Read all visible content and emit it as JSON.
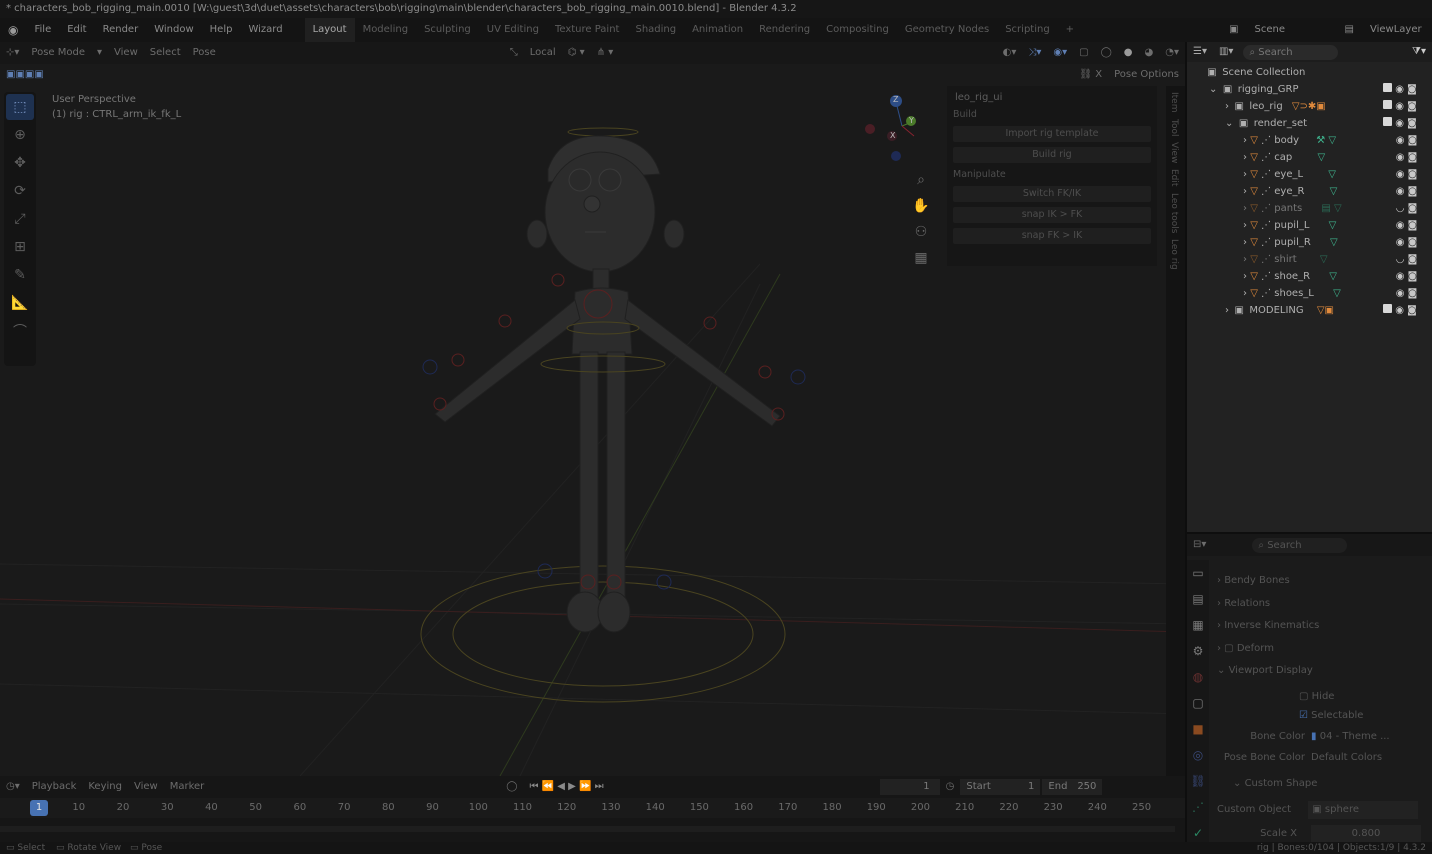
{
  "titlebar": {
    "text": "* characters_bob_rigging_main.0010 [W:\\guest\\3d\\duet\\assets\\characters\\bob\\rigging\\main\\blender\\characters_bob_rigging_main.0010.blend] - Blender 4.3.2"
  },
  "menu": {
    "items": [
      "File",
      "Edit",
      "Render",
      "Window",
      "Help",
      "Wizard"
    ]
  },
  "workspaces": {
    "tabs": [
      "Layout",
      "Modeling",
      "Sculpting",
      "UV Editing",
      "Texture Paint",
      "Shading",
      "Animation",
      "Rendering",
      "Compositing",
      "Geometry Nodes",
      "Scripting"
    ],
    "add": "+"
  },
  "scene": {
    "label": "Scene",
    "view_layer": "ViewLayer"
  },
  "viewport_header": {
    "mode": "Pose Mode",
    "view": "View",
    "select": "Select",
    "pose": "Pose",
    "transform_orientation": "Local",
    "pose_options": "Pose Options"
  },
  "viewport": {
    "perspective": "User Perspective",
    "active": "(1) rig : CTRL_arm_ik_fk_L"
  },
  "gizmo": {
    "z": "Z",
    "y": "Y",
    "x": "X"
  },
  "npanel": {
    "title": "leo_rig_ui",
    "build_label": "Build",
    "import_btn": "Import rig template",
    "build_btn": "Build rig",
    "manipulate_label": "Manipulate",
    "switch_btn": "Switch FK/IK",
    "snap_ik_btn": "snap IK > FK",
    "snap_fk_btn": "snap FK > IK",
    "tabs": [
      "Item",
      "Tool",
      "View",
      "Edit",
      "Leo tools",
      "Leo rig"
    ]
  },
  "outliner": {
    "search_placeholder": "Search",
    "root": "Scene Collection",
    "rows": [
      {
        "label": "rigging_GRP"
      },
      {
        "label": "leo_rig"
      },
      {
        "label": "render_set"
      },
      {
        "label": "body"
      },
      {
        "label": "cap"
      },
      {
        "label": "eye_L"
      },
      {
        "label": "eye_R"
      },
      {
        "label": "pants"
      },
      {
        "label": "pupil_L"
      },
      {
        "label": "pupil_R"
      },
      {
        "label": "shirt"
      },
      {
        "label": "shoe_R"
      },
      {
        "label": "shoes_L"
      },
      {
        "label": "MODELING"
      }
    ]
  },
  "properties": {
    "search_placeholder": "Search",
    "bendy_bones": "Bendy Bones",
    "relations": "Relations",
    "inverse_kinematics": "Inverse Kinematics",
    "deform": "Deform",
    "viewport_display": "Viewport Display",
    "hide": "Hide",
    "selectable": "Selectable",
    "bone_color_label": "Bone Color",
    "bone_color_value": "04 - Theme ...",
    "pose_bone_color_label": "Pose Bone Color",
    "pose_bone_color_value": "Default Colors",
    "custom_shape": "Custom Shape",
    "custom_object_label": "Custom Object",
    "custom_object_value": "sphere",
    "scale_x_label": "Scale X",
    "scale_x_value": "0.800"
  },
  "timeline": {
    "playback": "Playback",
    "keying": "Keying",
    "view": "View",
    "marker": "Marker",
    "current_frame": "1",
    "start_label": "Start",
    "start_value": "1",
    "end_label": "End",
    "end_value": "250",
    "frames": [
      "1",
      "10",
      "20",
      "30",
      "40",
      "50",
      "60",
      "70",
      "80",
      "90",
      "100",
      "110",
      "120",
      "130",
      "140",
      "150",
      "160",
      "170",
      "180",
      "190",
      "200",
      "210",
      "220",
      "230",
      "240",
      "250"
    ]
  },
  "statusbar": {
    "select": "Select",
    "rotate": "Rotate View",
    "pose": "Pose",
    "right": "rig | Bones:0/104 | Objects:1/9 | 4.3.2"
  },
  "colors": {
    "accent_blue": "#4772b3",
    "mesh_orange": "#e08a3c",
    "data_green": "#3fb58f",
    "active_tab": "#202020"
  }
}
